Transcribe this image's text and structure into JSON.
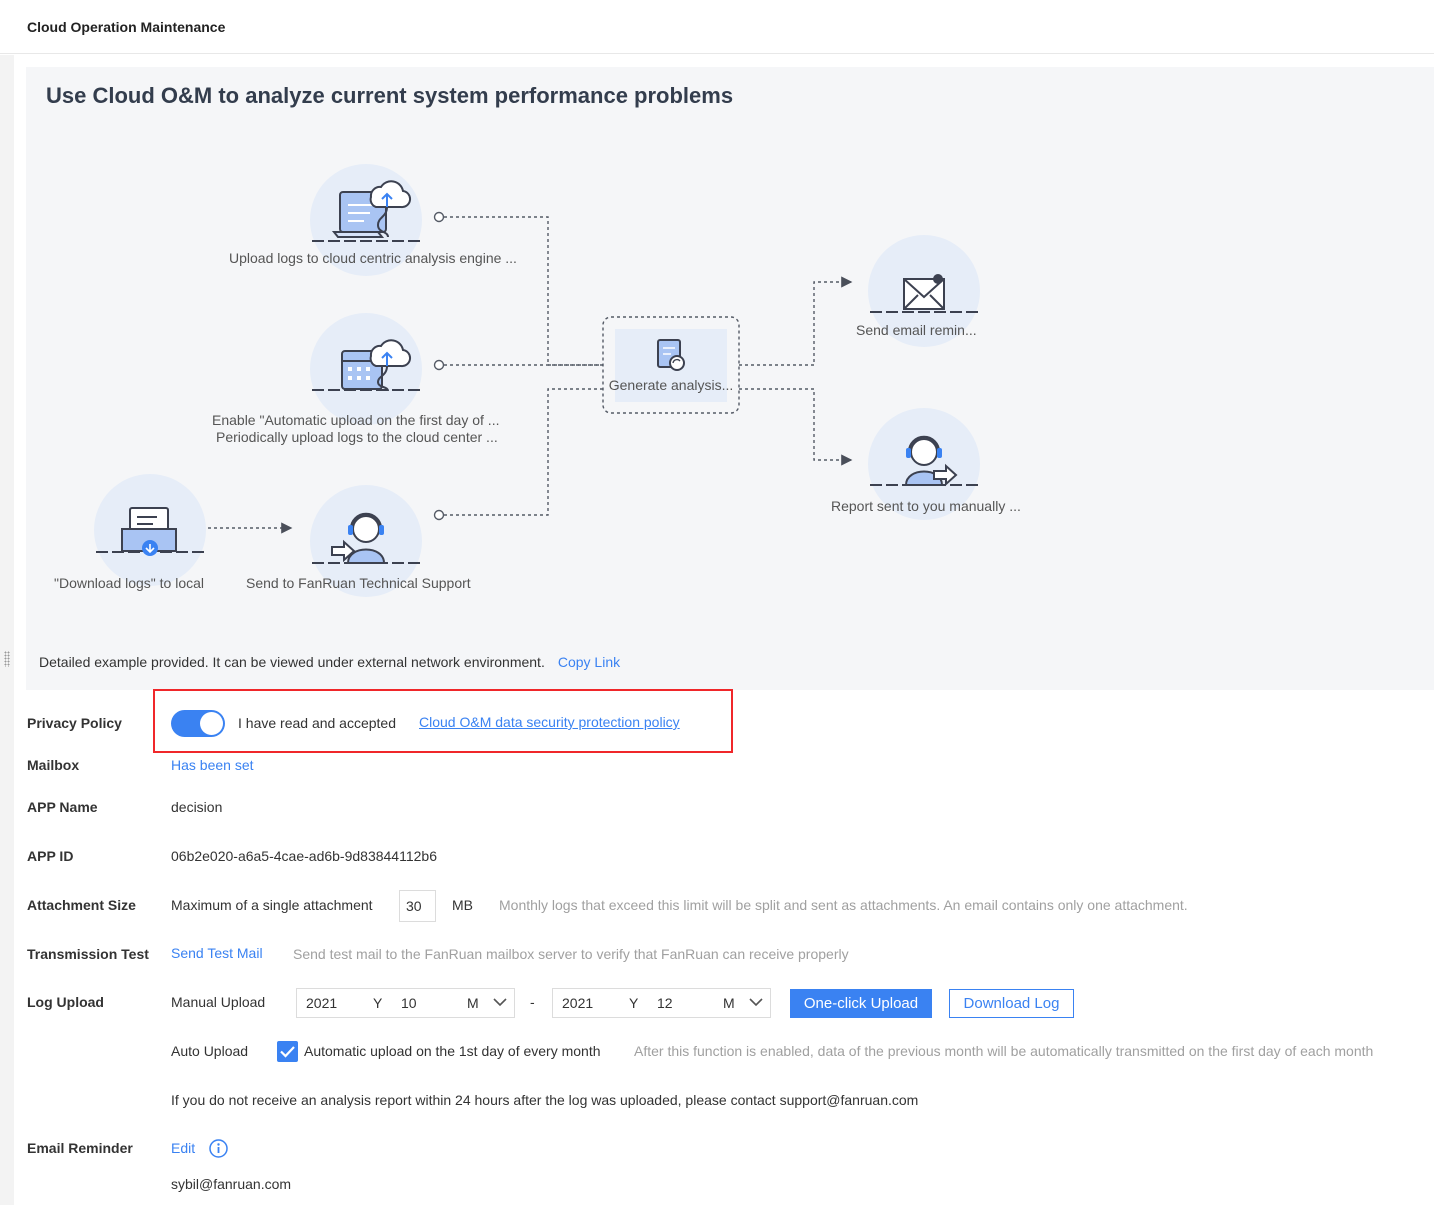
{
  "header": {
    "title": "Cloud Operation Maintenance"
  },
  "hero": {
    "title": "Use Cloud O&M to analyze current system performance problems",
    "nodes": {
      "upload_cloud": "Upload logs to cloud centric analysis engine ...",
      "auto_upload_line1": "Enable \"Automatic upload on the first day of ...",
      "auto_upload_line2": "Periodically upload logs to the cloud center ...",
      "download_local": "\"Download logs\" to local",
      "send_support": "Send to FanRuan Technical Support",
      "generate": "Generate analysis...",
      "email_reminder": "Send email remin...",
      "report_manual": "Report sent to you manually ..."
    },
    "detail_text": "Detailed example provided. It can be viewed under external network environment.",
    "copy_link": "Copy Link"
  },
  "form": {
    "privacy": {
      "label": "Privacy Policy",
      "accepted_text": "I have read and accepted",
      "policy_link": "Cloud O&M data security protection policy",
      "enabled": true
    },
    "mailbox": {
      "label": "Mailbox",
      "value": "Has been set"
    },
    "app_name": {
      "label": "APP Name",
      "value": "decision"
    },
    "app_id": {
      "label": "APP ID",
      "value": "06b2e020-a6a5-4cae-ad6b-9d83844112b6"
    },
    "attachment": {
      "label": "Attachment Size",
      "prefix": "Maximum of a single attachment",
      "value": "30",
      "unit": "MB",
      "hint": "Monthly logs that exceed this limit will be split and sent as attachments. An email contains only one attachment."
    },
    "transmission": {
      "label": "Transmission Test",
      "link": "Send Test Mail",
      "hint": "Send test mail to the FanRuan mailbox server to verify that FanRuan can receive properly"
    },
    "log_upload": {
      "label": "Log Upload",
      "manual_label": "Manual Upload",
      "start": {
        "year": "2021",
        "year_unit": "Y",
        "month": "10",
        "month_unit": "M"
      },
      "separator": "-",
      "end": {
        "year": "2021",
        "year_unit": "Y",
        "month": "12",
        "month_unit": "M"
      },
      "upload_btn": "One-click Upload",
      "download_btn": "Download Log",
      "auto_label": "Auto Upload",
      "auto_checkbox": "Automatic upload on the 1st day of every month",
      "auto_checked": true,
      "auto_hint": "After this function is enabled, data of the previous month will be automatically transmitted on the first day of each month",
      "notice": "If you do not receive an analysis report within 24 hours after the log was uploaded, please contact support@fanruan.com"
    },
    "email_reminder": {
      "label": "Email Reminder",
      "edit": "Edit",
      "email": "sybil@fanruan.com"
    }
  },
  "colors": {
    "accent": "#3a82f2",
    "highlight_box": "#f0272a",
    "hero_bg": "#f5f6f8"
  }
}
